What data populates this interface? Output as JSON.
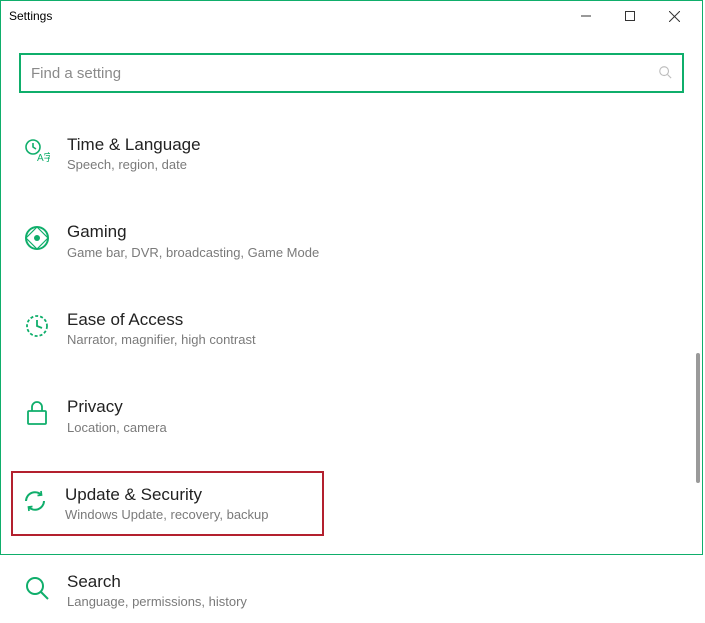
{
  "window": {
    "title": "Settings"
  },
  "search": {
    "placeholder": "Find a setting"
  },
  "items": [
    {
      "title": "Time & Language",
      "desc": "Speech, region, date",
      "icon": "time-language-icon"
    },
    {
      "title": "Gaming",
      "desc": "Game bar, DVR, broadcasting, Game Mode",
      "icon": "gaming-icon"
    },
    {
      "title": "Ease of Access",
      "desc": "Narrator, magnifier, high contrast",
      "icon": "ease-of-access-icon"
    },
    {
      "title": "Privacy",
      "desc": "Location, camera",
      "icon": "privacy-icon"
    },
    {
      "title": "Update & Security",
      "desc": "Windows Update, recovery, backup",
      "icon": "update-security-icon",
      "highlight": true
    },
    {
      "title": "Search",
      "desc": "Language, permissions, history",
      "icon": "search-nav-icon"
    }
  ],
  "colors": {
    "accent": "#0fae6b",
    "highlight": "#b3202e"
  }
}
